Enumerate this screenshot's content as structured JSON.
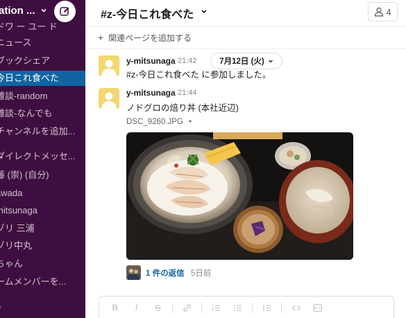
{
  "sidebar": {
    "workspace_name": "ation ...",
    "items": [
      {
        "label": "ドワ ー ユー ド"
      },
      {
        "label": "ニュース"
      },
      {
        "label": "ブックシェア"
      },
      {
        "label": "今日これ食べた"
      },
      {
        "label": "雑談-random"
      },
      {
        "label": "雑談-なんでも"
      },
      {
        "label": "チャンネルを追加..."
      },
      {
        "label": "ダイレクトメッセ..."
      },
      {
        "label": "藤 (崇) (自分)"
      },
      {
        "label": "awada"
      },
      {
        "label": "mitsunaga"
      },
      {
        "label": "ゾリ 三浦"
      },
      {
        "label": "ゾリ中丸"
      },
      {
        "label": "ちゃん"
      },
      {
        "label": "ームメンバーを..."
      },
      {
        "label": "p"
      }
    ]
  },
  "channel": {
    "title": "#z-今日これ食べた",
    "member_count": "4",
    "add_page": "関連ページを追加する"
  },
  "date_divider": "7月12日 (火)",
  "messages": [
    {
      "author": "y-mitsunaga",
      "time": "21:42",
      "text": "#z-今日これ食べた に参加しました。"
    },
    {
      "author": "y-mitsunaga",
      "time": "21:44",
      "text": "ノドグロの焙り丼 (本社近辺)",
      "attachment": "DSC_9260.JPG"
    }
  ],
  "thread": {
    "reply_count": "1 件の返信",
    "when": "5日前"
  },
  "composer": {
    "buttons": [
      "bold-icon",
      "italic-icon",
      "strike-icon",
      "link-icon",
      "ordered-list-icon",
      "bullet-list-icon",
      "blockquote-icon",
      "code-icon",
      "code-block-icon"
    ]
  }
}
